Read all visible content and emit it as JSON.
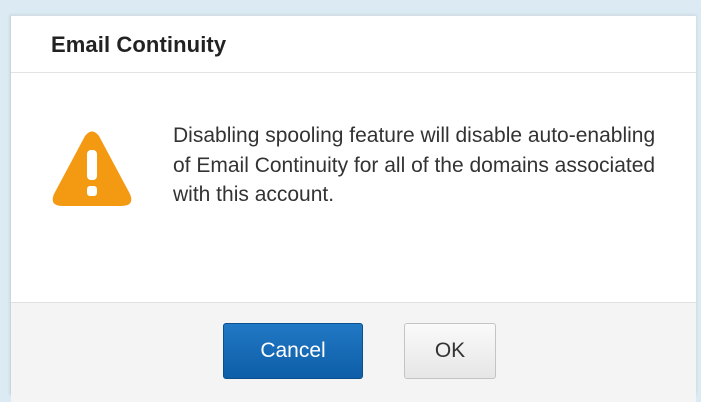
{
  "dialog": {
    "title": "Email Continuity",
    "icon": "warning-icon",
    "message": "Disabling spooling feature will disable auto-enabling of Email Continuity for all of the domains associated with this account.",
    "buttons": {
      "cancel_label": "Cancel",
      "ok_label": "OK"
    }
  },
  "colors": {
    "backdrop": "#dcebf3",
    "warning_icon": "#f39a12",
    "primary_button": "#1a6db8",
    "footer": "#f4f4f4"
  }
}
